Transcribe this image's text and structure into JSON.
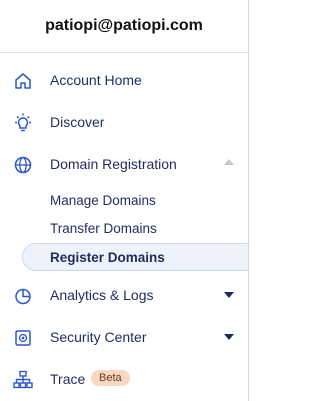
{
  "account": {
    "email": "patiopi@patiopi.com"
  },
  "nav": {
    "account_home": {
      "label": "Account Home",
      "icon": "home-icon"
    },
    "discover": {
      "label": "Discover",
      "icon": "lightbulb-icon"
    },
    "domain_registration": {
      "label": "Domain Registration",
      "icon": "globe-icon",
      "expanded": true,
      "sub_items": [
        "Manage Domains",
        "Transfer Domains",
        "Register Domains"
      ],
      "active_sub_item": "Register Domains"
    },
    "analytics_logs": {
      "label": "Analytics & Logs",
      "icon": "chart-icon"
    },
    "security_center": {
      "label": "Security Center",
      "icon": "security-icon"
    },
    "trace": {
      "label": "Trace",
      "icon": "network-icon",
      "badge": "Beta"
    }
  },
  "colors": {
    "icon": "#2c56c9",
    "text": "#1f2b5c",
    "active_bg": "#eef3fb",
    "badge_bg": "#f8d8c2"
  }
}
